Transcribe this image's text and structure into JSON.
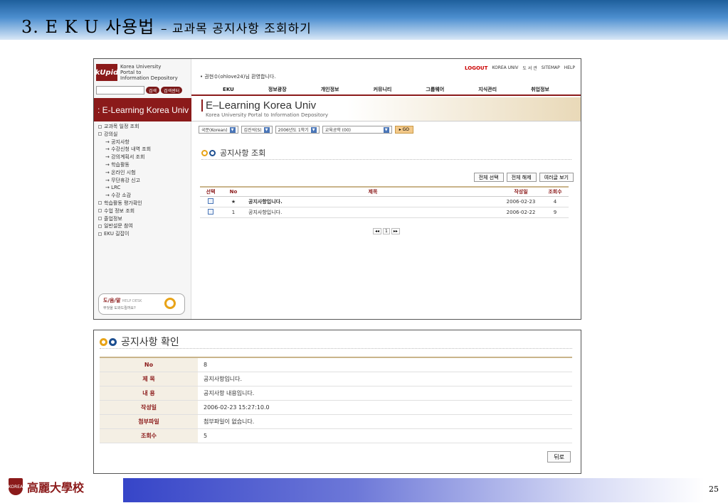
{
  "slide": {
    "title": "3. E K U 사용법",
    "subtitle": "– 교과목 공지사항 조회하기",
    "page_number": "25",
    "university": "高麗大學校",
    "crest_text": "KOREA"
  },
  "portal": {
    "logo_mark": "kUpid",
    "logo_line1": "Korea University",
    "logo_line2": "Portal to",
    "logo_line3": "Information Depository",
    "search_btn": "검색",
    "search_center_btn": "검색센터",
    "welcome": "• 권현수(ohlove24)님 환영합니다.",
    "top_links": [
      "LOGOUT",
      "KOREA UNIV",
      "도 서 관",
      "SITEMAP",
      "HELP"
    ],
    "nav": [
      "EKU",
      "정보광장",
      "개인정보",
      "커뮤니티",
      "그룹웨어",
      "지식관리",
      "취업정보"
    ],
    "banner": ": E-Learning Korea Univ",
    "elk_title": "E–Learning Korea Univ",
    "elk_subtitle": "Korea University Portal to Information Depository",
    "filters": [
      "국문(Korean)",
      "김진석(S)",
      "2006년도 1학기",
      "교육공학 (00)"
    ],
    "go_label": "▸ GO",
    "menu": [
      {
        "label": "교과목 일정 조회",
        "sub": false
      },
      {
        "label": "강의실",
        "sub": false
      },
      {
        "label": "→ 공지사항",
        "sub": true
      },
      {
        "label": "→ 수강신청 내역 조회",
        "sub": true
      },
      {
        "label": "→ 강의계획서 조회",
        "sub": true
      },
      {
        "label": "→ 학습활동",
        "sub": true
      },
      {
        "label": "→ 온라인 시험",
        "sub": true
      },
      {
        "label": "→ 무단휴강 신고",
        "sub": true
      },
      {
        "label": "→ LRC",
        "sub": true
      },
      {
        "label": "→ 수강 소감",
        "sub": true
      },
      {
        "label": "학습활동 평가확인",
        "sub": false
      },
      {
        "label": "수업 정보 조회",
        "sub": false
      },
      {
        "label": "졸업정보",
        "sub": false
      },
      {
        "label": "일반설문 참여",
        "sub": false
      },
      {
        "label": "EKU 길잡이",
        "sub": false
      }
    ],
    "help_title": "도/움/말",
    "help_small": "HELP DESK",
    "help_sub": "무엇을 도와드릴까요?"
  },
  "notice_list": {
    "heading": "공지사항 조회",
    "buttons": [
      "전체 선택",
      "전체 해제",
      "여러글 보기"
    ],
    "columns": [
      "선택",
      "No",
      "제목",
      "작성일",
      "조회수"
    ],
    "rows": [
      {
        "no": "★",
        "title": "공지사항입니다.",
        "date": "2006-02-23",
        "views": "4"
      },
      {
        "no": "1",
        "title": "공지사항입니다.",
        "date": "2006-02-22",
        "views": "9"
      }
    ],
    "pager_prev": "◂◂",
    "pager_page": "1",
    "pager_next": "▸▸"
  },
  "notice_detail": {
    "heading": "공지사항 확인",
    "fields": [
      {
        "label": "No",
        "value": "8"
      },
      {
        "label": "제 목",
        "value": "공지사항입니다."
      },
      {
        "label": "내 용",
        "value": "공지사항 내용입니다."
      },
      {
        "label": "작성일",
        "value": "2006-02-23 15:27:10.0"
      },
      {
        "label": "첨부파일",
        "value": "첨부파일이 없습니다."
      },
      {
        "label": "조회수",
        "value": "5"
      }
    ],
    "back_label": "뒤로"
  }
}
